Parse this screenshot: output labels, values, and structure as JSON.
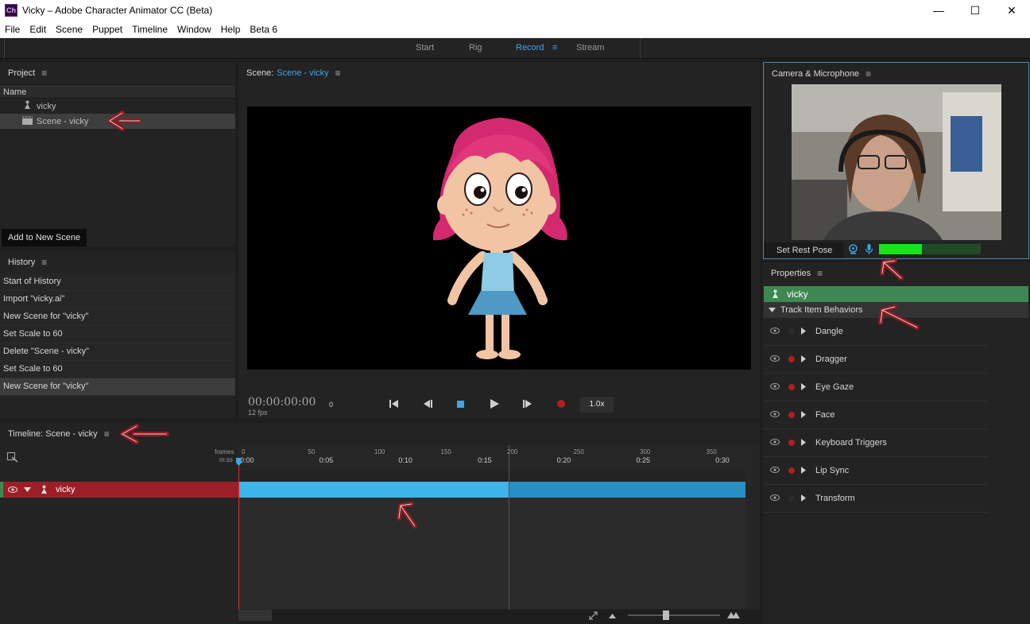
{
  "window": {
    "app_icon": "Ch",
    "title": "Vicky – Adobe Character Animator CC (Beta)",
    "minimize": "—",
    "maximize": "☐",
    "close": "✕"
  },
  "menu": [
    "File",
    "Edit",
    "Scene",
    "Puppet",
    "Timeline",
    "Window",
    "Help",
    "Beta 6"
  ],
  "workspace": {
    "tabs": [
      {
        "label": "Start",
        "active": false
      },
      {
        "label": "Rig",
        "active": false
      },
      {
        "label": "Record",
        "active": true
      },
      {
        "label": "Stream",
        "active": false
      }
    ],
    "menu_icon": "≡"
  },
  "project": {
    "title": "Project",
    "menu_icon": "≡",
    "column": "Name",
    "items": [
      {
        "label": "vicky",
        "icon": "puppet-icon"
      },
      {
        "label": "Scene - vicky",
        "icon": "scene-icon"
      }
    ],
    "add_button": "Add to New Scene"
  },
  "history": {
    "title": "History",
    "menu_icon": "≡",
    "items": [
      "Start of History",
      "Import \"vicky.ai\"",
      "New Scene for \"vicky\"",
      "Set Scale to 60",
      "Delete \"Scene - vicky\"",
      "Set Scale to 60",
      "New Scene for \"vicky\""
    ]
  },
  "scene": {
    "label": "Scene:",
    "name": "Scene - vicky",
    "menu_icon": "≡",
    "timecode": "00:00:00:00",
    "frame": "0",
    "fps": "12 fps",
    "speed": "1.0x"
  },
  "camera": {
    "title": "Camera & Microphone",
    "menu_icon": "≡",
    "rest_pose": "Set Rest Pose",
    "mic_level": 0.42
  },
  "properties": {
    "title": "Properties",
    "menu_icon": "≡",
    "puppet": "vicky",
    "section": "Track Item Behaviors",
    "behaviors": [
      {
        "name": "Dangle",
        "armed": false
      },
      {
        "name": "Dragger",
        "armed": true
      },
      {
        "name": "Eye Gaze",
        "armed": true
      },
      {
        "name": "Face",
        "armed": true
      },
      {
        "name": "Keyboard Triggers",
        "armed": true
      },
      {
        "name": "Lip Sync",
        "armed": true
      },
      {
        "name": "Transform",
        "armed": false
      }
    ]
  },
  "timeline": {
    "title": "Timeline: Scene - vicky",
    "menu_icon": "≡",
    "frames_label": "frames",
    "time_label": "m:ss",
    "frame_ticks": [
      "0",
      "50",
      "100",
      "150",
      "200",
      "250",
      "300",
      "350"
    ],
    "time_ticks": [
      "0:00",
      "0:05",
      "0:10",
      "0:15",
      "0:20",
      "0:25",
      "0:30"
    ],
    "track": "vicky"
  },
  "colors": {
    "accent": "#3ea6e6",
    "track_red": "#9c1f28",
    "puppet_green": "#3f8752",
    "record_red": "#b01e1e",
    "annotation_arrow": "#8e1b22"
  }
}
